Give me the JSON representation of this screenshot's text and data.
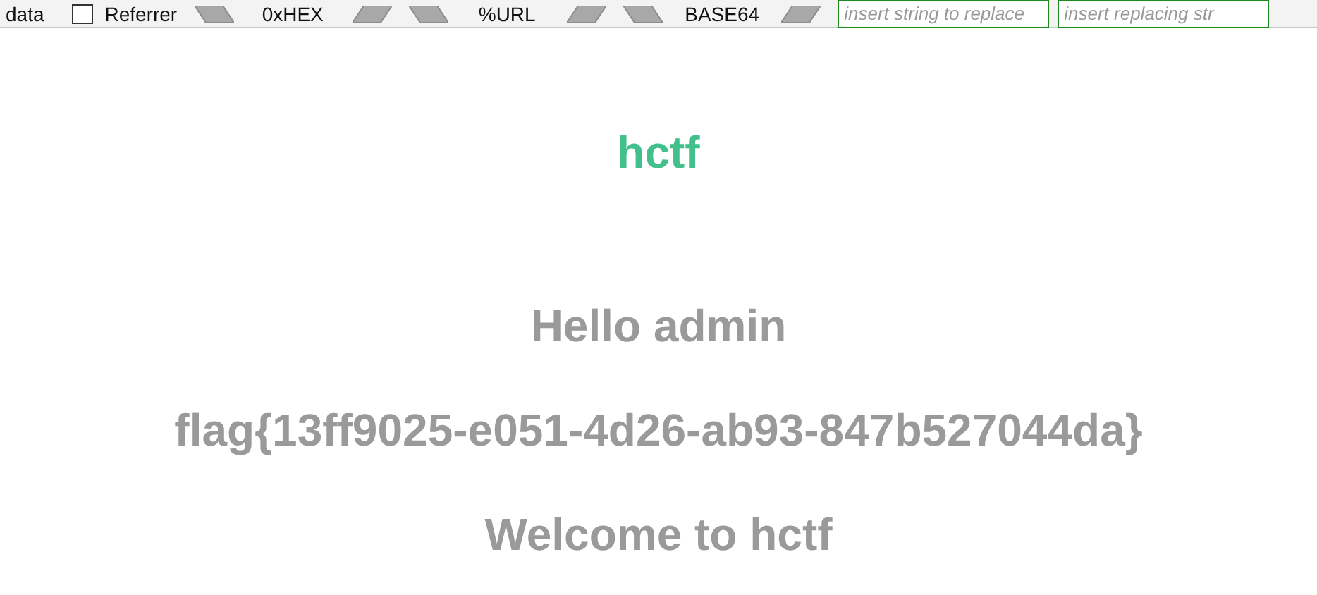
{
  "toolbar": {
    "post_data_label": "data",
    "referrer": {
      "label": "Referrer",
      "checked": false
    },
    "encoders": [
      "0xHEX",
      "%URL",
      "BASE64"
    ],
    "replace_fields": [
      {
        "placeholder": "insert string to replace"
      },
      {
        "placeholder": "insert replacing str"
      }
    ]
  },
  "page": {
    "title": "hctf",
    "lines": [
      "Hello admin",
      "flag{13ff9025-e051-4d26-ab93-847b527044da}",
      "Welcome to hctf"
    ]
  }
}
